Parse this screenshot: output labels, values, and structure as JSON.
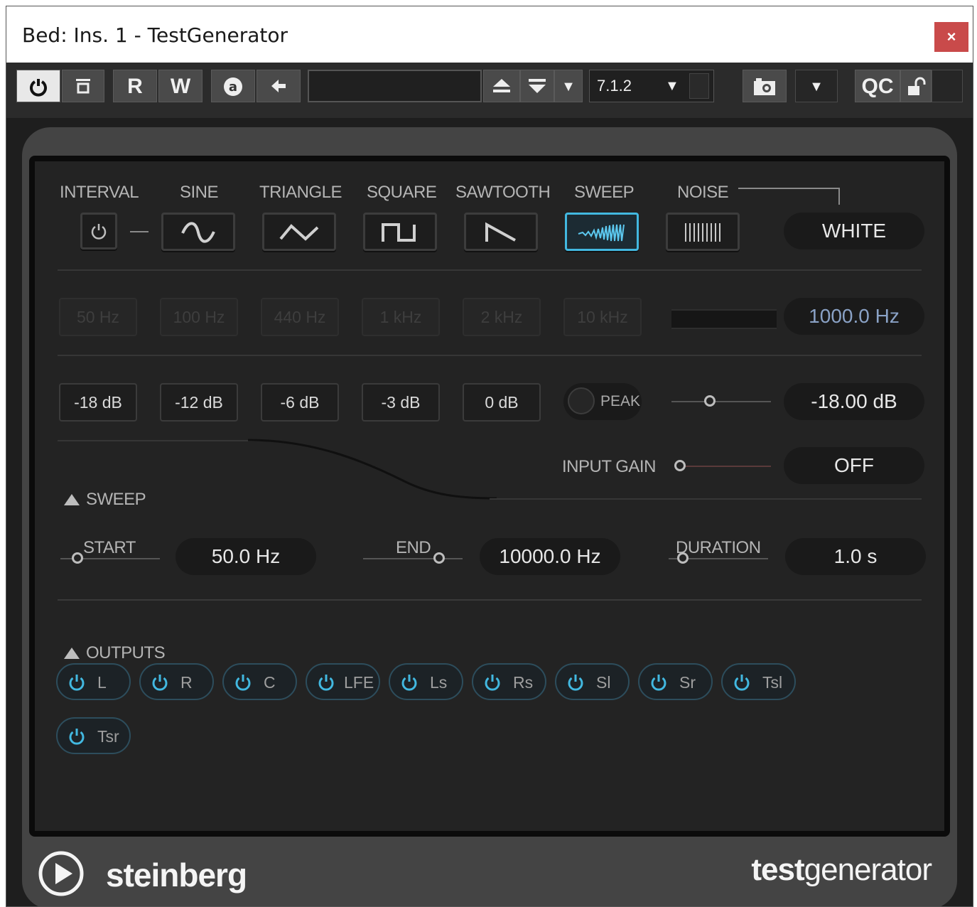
{
  "window": {
    "title": "Bed: Ins. 1 - TestGenerator",
    "close_label": "×"
  },
  "toolbar": {
    "read_label": "R",
    "write_label": "W",
    "preset_name": "",
    "channel_config": "7.1.2",
    "qc_label": "QC"
  },
  "waveforms": {
    "interval_label": "INTERVAL",
    "sine_label": "SINE",
    "triangle_label": "TRIANGLE",
    "square_label": "SQUARE",
    "sawtooth_label": "SAWTOOTH",
    "sweep_label": "SWEEP",
    "noise_label": "NOISE",
    "noise_type": "WHITE",
    "selected": "SWEEP"
  },
  "frequency": {
    "presets": [
      "50 Hz",
      "100 Hz",
      "440 Hz",
      "1 kHz",
      "2 kHz",
      "10 kHz"
    ],
    "value": "1000.0 Hz"
  },
  "level": {
    "presets": [
      "-18 dB",
      "-12 dB",
      "-6 dB",
      "-3 dB",
      "0 dB"
    ],
    "peak_label": "PEAK",
    "value": "-18.00 dB",
    "input_gain_label": "INPUT GAIN",
    "input_gain_value": "OFF"
  },
  "sweep": {
    "section_label": "SWEEP",
    "start_label": "START",
    "start_value": "50.0 Hz",
    "end_label": "END",
    "end_value": "10000.0 Hz",
    "duration_label": "DURATION",
    "duration_value": "1.0 s"
  },
  "outputs": {
    "section_label": "OUTPUTS",
    "channels": [
      "L",
      "R",
      "C",
      "LFE",
      "Ls",
      "Rs",
      "Sl",
      "Sr",
      "Tsl",
      "Tsr"
    ]
  },
  "footer": {
    "brand": "steinberg",
    "product_bold": "test",
    "product_light": "generator"
  },
  "colors": {
    "accent": "#42b8e0",
    "panel_bg": "#232323",
    "frame_bg": "#444444",
    "close_red": "#c94a4a"
  }
}
